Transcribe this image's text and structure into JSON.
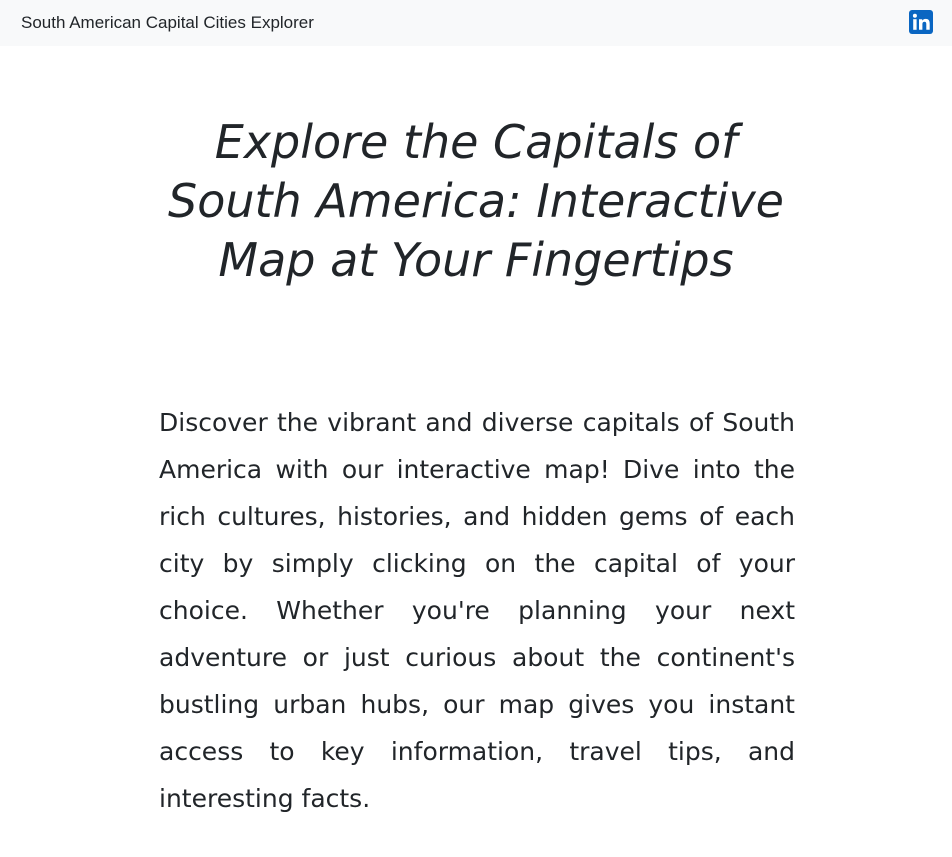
{
  "navbar": {
    "brand": "South American Capital Cities Explorer",
    "social_icon": "linkedin-icon",
    "social_color": "#0a66c2"
  },
  "hero": {
    "title": "Explore the Capitals of South America: Interactive Map at Your Fingertips",
    "description": "Discover the vibrant and diverse capitals of South America with our interactive map! Dive into the rich cultures, histories, and hidden gems of each city by simply clicking on the capital of your choice. Whether you're planning your next adventure or just curious about the continent's bustling urban hubs, our map gives you instant access to key information, travel tips, and interesting facts."
  }
}
